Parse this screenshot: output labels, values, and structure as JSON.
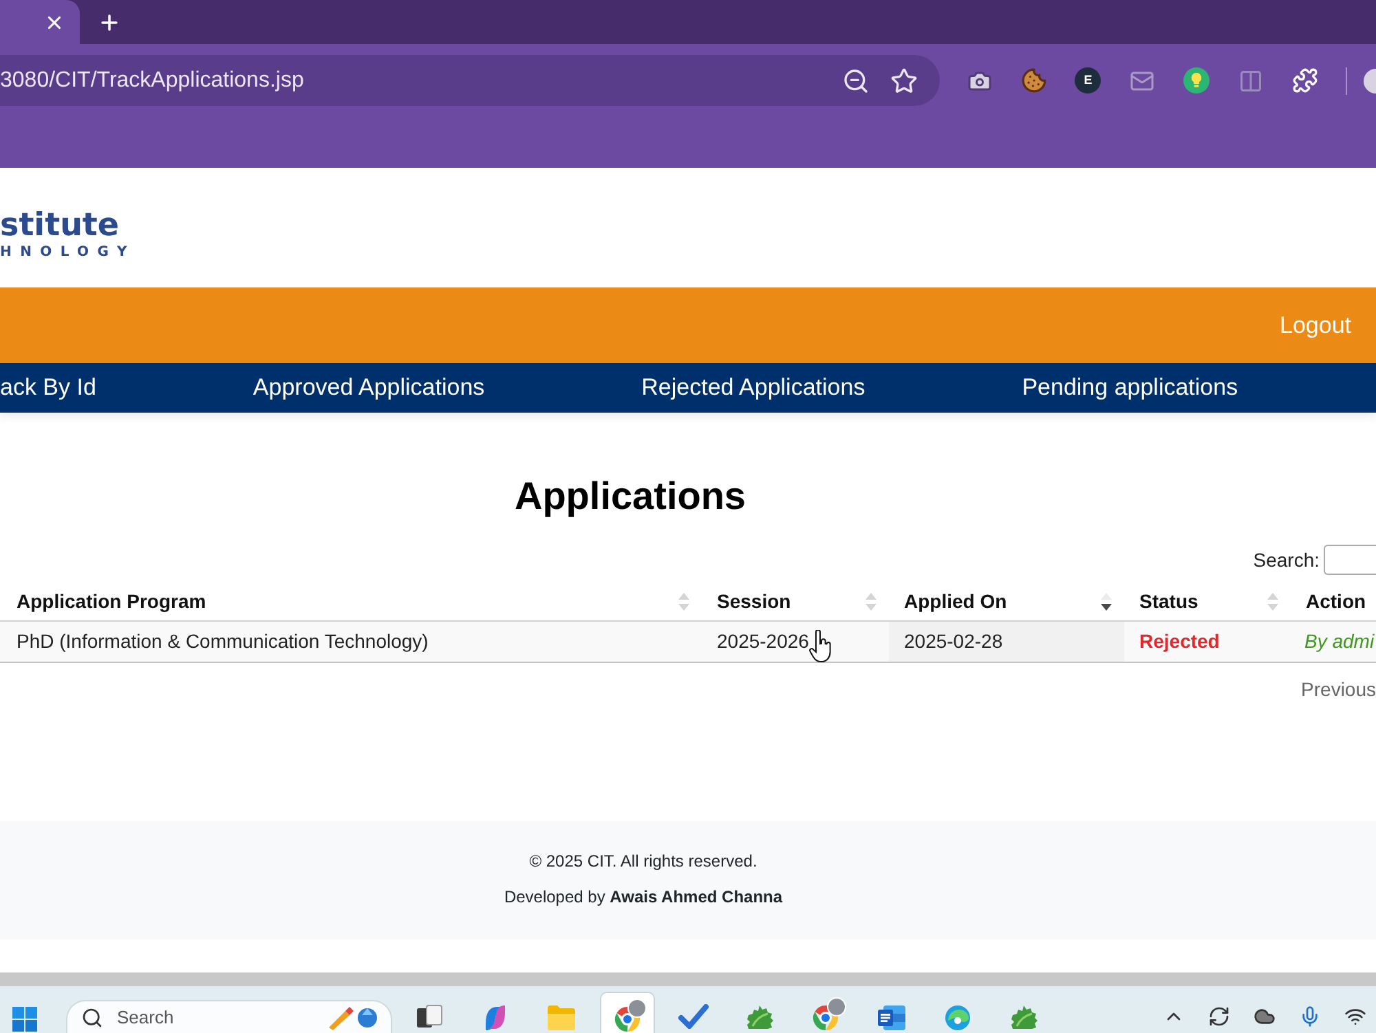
{
  "browser": {
    "address": "3080/CIT/TrackApplications.jsp",
    "extension_badge": "E"
  },
  "header": {
    "logo_wordmark": "stitute",
    "logo_tagline": "HNOLOGY"
  },
  "top_bar": {
    "logout": "Logout"
  },
  "nav": [
    {
      "label": "ack By Id"
    },
    {
      "label": "Approved Applications"
    },
    {
      "label": "Rejected Applications"
    },
    {
      "label": "Pending applications"
    }
  ],
  "page": {
    "title": "Applications",
    "search_label": "Search:"
  },
  "table": {
    "columns": [
      {
        "label": "Application Program",
        "sorted": false
      },
      {
        "label": "Session",
        "sorted": false
      },
      {
        "label": "Applied On",
        "sorted": true,
        "descending": true
      },
      {
        "label": "Status",
        "sorted": false
      },
      {
        "label": "Action"
      }
    ],
    "rows": [
      {
        "cells": [
          {
            "kind": "text",
            "text": "PhD (Information & Communication Technology)"
          },
          {
            "kind": "text",
            "text": "2025-2026"
          },
          {
            "kind": "text",
            "text": "2025-02-28"
          },
          {
            "kind": "status",
            "text": "Rejected"
          },
          {
            "kind": "action",
            "text": "By admi"
          }
        ]
      }
    ]
  },
  "pagination": {
    "previous": {
      "label": "Previous",
      "disabled": true
    }
  },
  "footer": {
    "copyright": "© 2025 CIT. All rights reserved.",
    "credit": "Developed by **Awais Ahmed Channa**"
  },
  "taskbar": {
    "search_placeholder": "Search",
    "apps": [
      {
        "kind": "task-view",
        "active": false
      },
      {
        "kind": "copilot",
        "active": false
      },
      {
        "kind": "folder",
        "active": false
      },
      {
        "kind": "browser",
        "active": true
      },
      {
        "kind": "todo",
        "active": false
      },
      {
        "kind": "leaf",
        "active": false
      },
      {
        "kind": "browser",
        "active": false
      },
      {
        "kind": "word",
        "active": false
      },
      {
        "kind": "edge",
        "active": false
      },
      {
        "kind": "leaf",
        "active": false
      }
    ]
  }
}
